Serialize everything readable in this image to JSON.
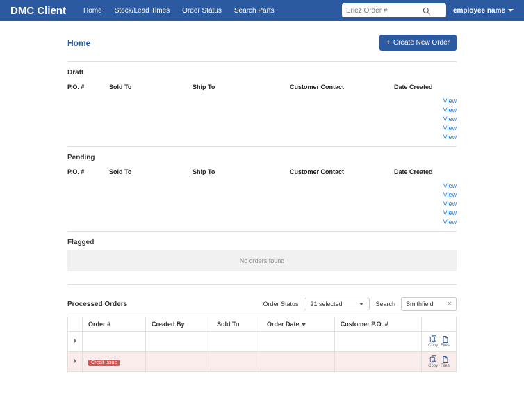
{
  "brand": "DMC Client",
  "nav": {
    "home": "Home",
    "stock": "Stock/Lead Times",
    "order_status": "Order Status",
    "search_parts": "Search Parts"
  },
  "search": {
    "placeholder": "Eriez Order #"
  },
  "employee_label": "employee name",
  "page": {
    "title": "Home",
    "create_btn": "Create New Order"
  },
  "cols": {
    "po": "P.O. #",
    "sold_to": "Sold To",
    "ship_to": "Ship To",
    "contact": "Customer Contact",
    "created": "Date Created"
  },
  "sections": {
    "draft": {
      "title": "Draft",
      "views": [
        "View",
        "View",
        "View",
        "View",
        "View"
      ]
    },
    "pending": {
      "title": "Pending",
      "views": [
        "View",
        "View",
        "View",
        "View",
        "View"
      ]
    },
    "flagged": {
      "title": "Flagged",
      "empty": "No orders found"
    }
  },
  "processed": {
    "title": "Processed Orders",
    "filters": {
      "status_label": "Order Status",
      "status_value": "21 selected",
      "search_label": "Search",
      "search_value": "Smithfield"
    },
    "headers": {
      "order": "Order #",
      "created_by": "Created By",
      "sold_to": "Sold To",
      "order_date": "Order Date",
      "customer_po": "Customer P.O. #"
    },
    "actions": {
      "copy": "Copy",
      "files": "Files"
    },
    "rows": [
      {
        "flag": null
      },
      {
        "flag": "Credit Issue"
      }
    ]
  }
}
